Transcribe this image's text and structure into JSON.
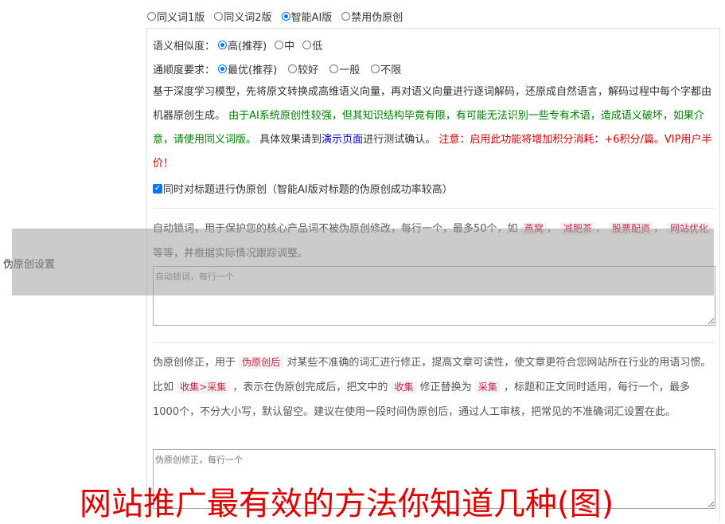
{
  "top_versions": {
    "options": [
      "同义词1版",
      "同义词2版",
      "智能AI版",
      "禁用伪原创"
    ],
    "selected_index": 2
  },
  "similarity": {
    "label": "语义相似度：",
    "options": [
      "高(推荐)",
      "中",
      "低"
    ],
    "selected_index": 0
  },
  "fluency": {
    "label": "通顺度要求：",
    "options": [
      "最优(推荐)",
      "较好",
      "一般",
      "不限"
    ],
    "selected_index": 0
  },
  "description": {
    "part1": "基于深度学习模型，先将原文转换成高维语义向量，再对语义向量进行逐词解码，还原成自然语言，解码过程中每个字都由机器原创生成。",
    "part2_green": "由于AI系统原创性较强，但其知识结构毕竟有限，有可能无法识别一些专有术语，造成语义破坏，如果介意，请使用同义词版。",
    "part3": "具体效果请到",
    "link": "演示页面",
    "part4": "进行测试确认。",
    "part5_red": "注意：启用此功能将增加积分消耗：+6积分/篇。VIP用户半价！"
  },
  "title_option": {
    "checked": true,
    "label": "同时对标题进行伪原创（智能AI版对标题的伪原创成功率较高）"
  },
  "lock_words": {
    "text_pre": "自动锁词，用于保护您的核心产品词不被伪原创修改，每行一个，最多50个，如",
    "examples": [
      "燕窝",
      "减肥茶",
      "股票配资",
      "网站优化"
    ],
    "text_post": "等等，并根据实际情况跟踪调整。",
    "placeholder": "自动锁词，每行一个"
  },
  "correction": {
    "text1": "伪原创修正，用于",
    "tag1": "伪原创后",
    "text2": "对某些不准确的词汇进行修正，提高文章可读性，使文章更符合您网站所在行业的用语习惯。比如",
    "tag2": "收集>采集",
    "text3": "，表示在伪原创完成后，把文中的",
    "tag3": "收集",
    "text4": "修正替换为",
    "tag4": "采集",
    "text5": "，标题和正文同时适用，每行一个，最多1000个，不分大小写，默认留空。建议在使用一段时间伪原创后，通过人工审核，把常见的不准确词汇设置在此。",
    "placeholder": "伪原创修正，每行一个"
  },
  "side_label": "伪原创设置",
  "watermark": "网站推广最有效的方法你知道几种(图)",
  "colors": {
    "accent": "#0075ff",
    "green_text": "#008000",
    "red_text": "#d40000",
    "link": "#0000cc",
    "tag_bg": "#f5f2f0",
    "tag_fg": "#c7254e"
  }
}
